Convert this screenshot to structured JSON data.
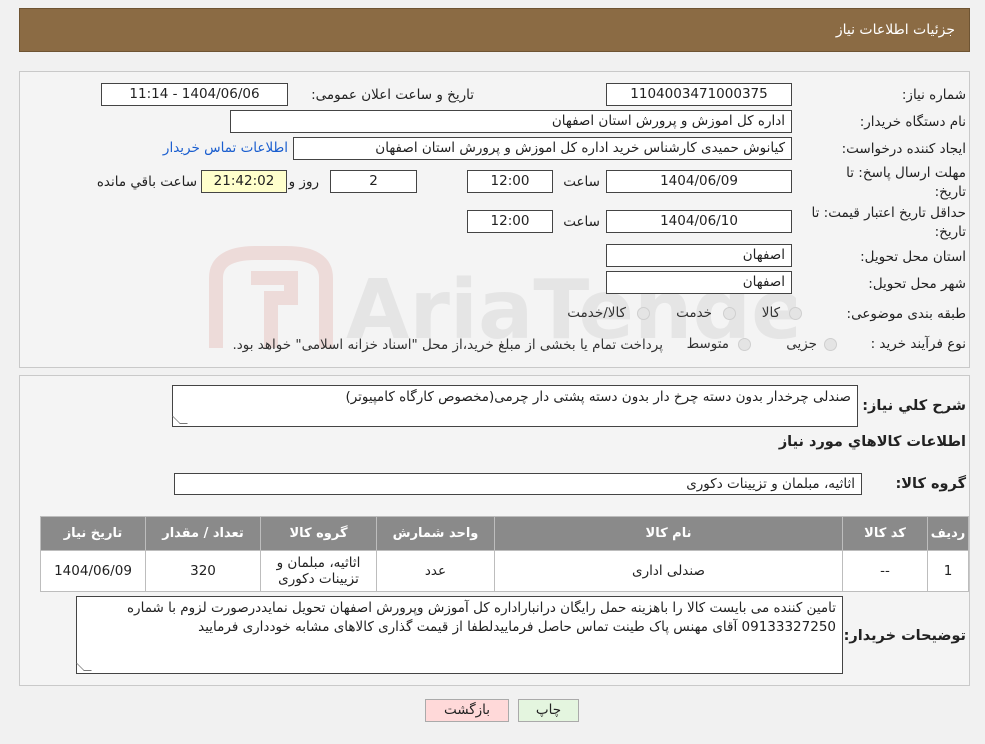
{
  "header": {
    "title": "جزئیات اطلاعات نیاز"
  },
  "form": {
    "need_number_label": "شماره نیاز:",
    "need_number": "1104003471000375",
    "announce_label": "تاریخ و ساعت اعلان عمومی:",
    "announce_value": "1404/06/06 - 11:14",
    "buyer_org_label": "نام دستگاه خریدار:",
    "buyer_org": "اداره کل اموزش و پرورش استان اصفهان",
    "creator_label": "ایجاد کننده درخواست:",
    "creator": "کیانوش حمیدی کارشناس خرید اداره کل اموزش و پرورش استان اصفهان",
    "contact_link": "اطلاعات تماس خریدار",
    "deadline_label_1": "مهلت ارسال پاسخ: تا",
    "deadline_label_2": "تاریخ:",
    "deadline_date": "1404/06/09",
    "time_label": "ساعت",
    "deadline_time": "12:00",
    "days_value": "2",
    "days_label": "روز و",
    "remaining_time": "21:42:02",
    "remaining_label": "ساعت باقي مانده",
    "validity_label_1": "حداقل تاریخ اعتبار قیمت: تا",
    "validity_label_2": "تاریخ:",
    "validity_date": "1404/06/10",
    "validity_time": "12:00",
    "province_label": "استان محل تحویل:",
    "province": "اصفهان",
    "city_label": "شهر محل تحویل:",
    "city": "اصفهان",
    "category_label": "طبقه بندی موضوعی:",
    "category_options": [
      "کالا",
      "خدمت",
      "کالا/خدمت"
    ],
    "process_label": "نوع فرآیند خرید :",
    "process_options": [
      "جزیی",
      "متوسط"
    ],
    "process_note": "پرداخت تمام یا بخشی از مبلغ خرید،از محل \"اسناد خزانه اسلامی\" خواهد بود."
  },
  "details": {
    "description_label": "شرح کلي نياز:",
    "description": "صندلی چرخدار بدون دسته      چرخ دار بدون دسته پشتی دار چرمی(مخصوص کارگاه کامپیوتر)",
    "goods_info_title": "اطلاعات کالاهاي مورد نياز",
    "goods_group_label": "گروه کالا:",
    "goods_group": "اثاثیه، مبلمان و تزیینات دکوری",
    "table": {
      "headers": [
        "ردیف",
        "کد کالا",
        "نام کالا",
        "واحد شمارش",
        "گروه کالا",
        "تعداد / مقدار",
        "تاریخ نیاز"
      ],
      "rows": [
        [
          "1",
          "--",
          "صندلی اداری",
          "عدد",
          "اثاثیه، مبلمان و تزیینات دکوری",
          "320",
          "1404/06/09"
        ]
      ]
    },
    "buyer_notes_label": "توضیحات خریدار:",
    "buyer_notes": "تامین کننده می بایست کالا را باهزینه حمل رایگان درانباراداره کل آموزش وپرورش  اصفهان تحویل نمایددرصورت لزوم با شماره 09133327250 آقای مهنس پاک طینت تماس حاصل فرماییدلطفا از قیمت گذاری کالاهای مشابه خودداری فرمایید"
  },
  "buttons": {
    "print": "چاپ",
    "back": "بازگشت"
  },
  "watermark": "AriaTender.neT",
  "colors": {
    "header": "#8b6b44",
    "table_header": "#8a8a8a",
    "remaining_bg": "#ffffcc",
    "link": "#1a5ecf",
    "back_button": "#ffd9d9",
    "print_button": "#e4f5df"
  }
}
